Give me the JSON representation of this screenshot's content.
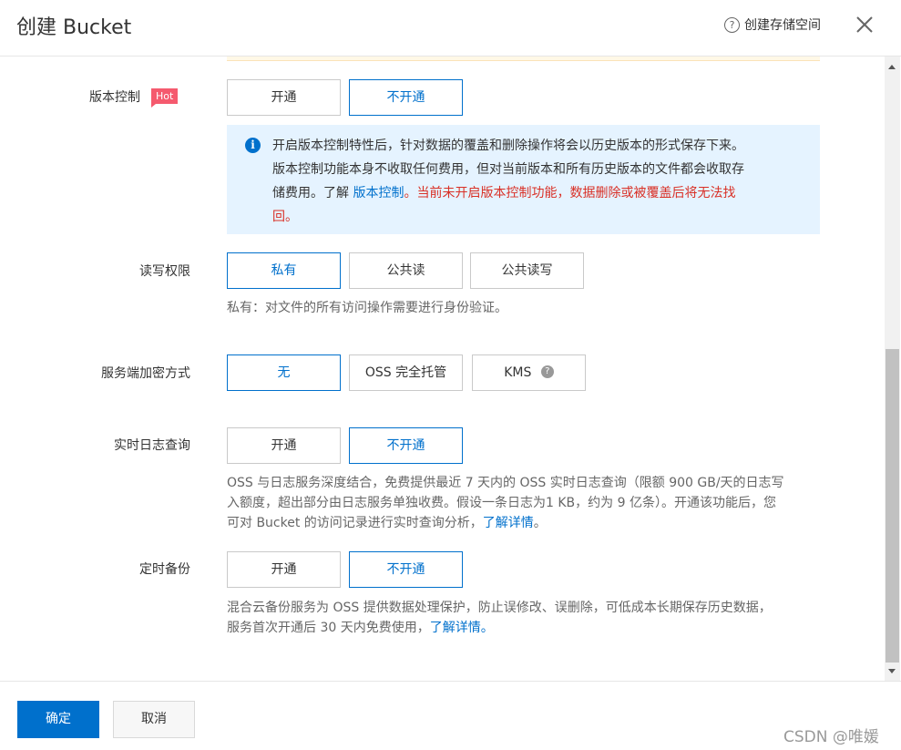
{
  "header": {
    "title": "创建 Bucket",
    "help_label": "创建存储空间"
  },
  "versioning": {
    "label": "版本控制",
    "hot_badge": "Hot",
    "options": [
      "开通",
      "不开通"
    ],
    "selected": "不开通",
    "info_line1": "开启版本控制特性后，针对数据的覆盖和删除操作将会以历史版本的形式保存下来。",
    "info_line2": "版本控制功能本身不收取任何费用，但对当前版本和所有历史版本的文件都会收取存",
    "info_line3_prefix": "储费用。了解 ",
    "info_link": "版本控制",
    "info_warn_line3": "。当前未开启版本控制功能，数据删除或被覆盖后将无法找",
    "info_warn_line4": "回。"
  },
  "acl": {
    "label": "读写权限",
    "options": [
      "私有",
      "公共读",
      "公共读写"
    ],
    "selected": "私有",
    "description": "私有：对文件的所有访问操作需要进行身份验证。"
  },
  "encryption": {
    "label": "服务端加密方式",
    "options": [
      "无",
      "OSS 完全托管",
      "KMS"
    ],
    "selected": "无"
  },
  "realtime_log": {
    "label": "实时日志查询",
    "options": [
      "开通",
      "不开通"
    ],
    "selected": "不开通",
    "desc_line1": "OSS 与日志服务深度结合，免费提供最近 7 天内的 OSS 实时日志查询（限额 900 GB/天的日志写",
    "desc_line2": "入额度，超出部分由日志服务单独收费。假设一条日志为1 KB，约为 9 亿条）。开通该功能后，您",
    "desc_line3_prefix": "可对 Bucket 的访问记录进行实时查询分析，",
    "desc_link": "了解详情",
    "desc_line3_suffix": "。"
  },
  "backup": {
    "label": "定时备份",
    "options": [
      "开通",
      "不开通"
    ],
    "selected": "不开通",
    "desc_line1": "混合云备份服务为 OSS 提供数据处理保护，防止误修改、误删除，可低成本长期保存历史数据，",
    "desc_line2_prefix": "服务首次开通后 30 天内免费使用，",
    "desc_link": "了解详情。"
  },
  "footer": {
    "ok_label": "确定",
    "cancel_label": "取消",
    "watermark": "CSDN @唯媛"
  },
  "colors": {
    "primary": "#0070cc",
    "warning": "#d93026",
    "hot": "#f55a6e",
    "info_bg": "#e5f3ff"
  }
}
